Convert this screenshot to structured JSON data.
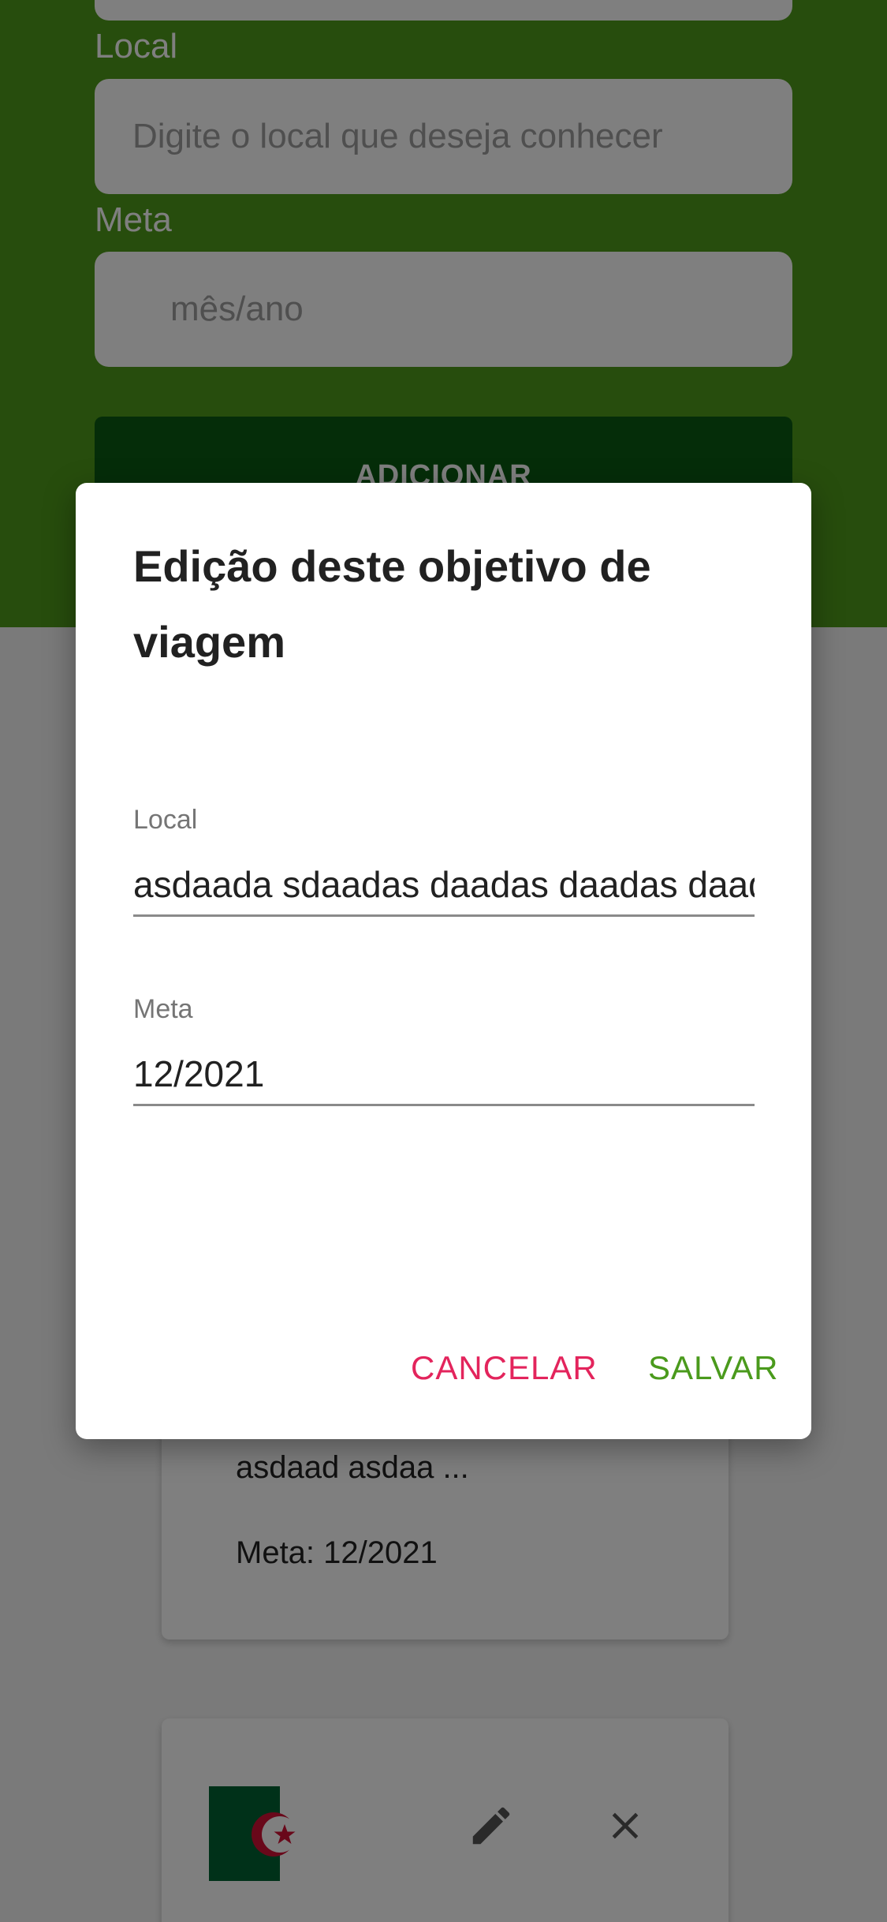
{
  "form": {
    "local_label": "Local",
    "local_placeholder": "Digite o local que deseja conhecer",
    "meta_label": "Meta",
    "meta_placeholder": "mês/ano",
    "add_button_label": "ADICIONAR"
  },
  "cards": [
    {
      "description": "asdaad asdaa ...",
      "meta": "Meta: 12/2021"
    },
    {
      "flag": "algeria-flag"
    }
  ],
  "dialog": {
    "title": "Edição deste objetivo de viagem",
    "local_label": "Local",
    "local_value": "asdaada sdaadas daadas daadas daadas",
    "meta_label": "Meta",
    "meta_value": "12/2021",
    "cancel_label": "CANCELAR",
    "save_label": "SALVAR"
  },
  "colors": {
    "header_green": "#4e9a1a",
    "button_dark_green": "#0b5a12",
    "cancel_pink": "#e3245c",
    "save_green": "#4a9a1c"
  },
  "icons": [
    "pencil-icon",
    "close-icon",
    "algeria-flag"
  ]
}
